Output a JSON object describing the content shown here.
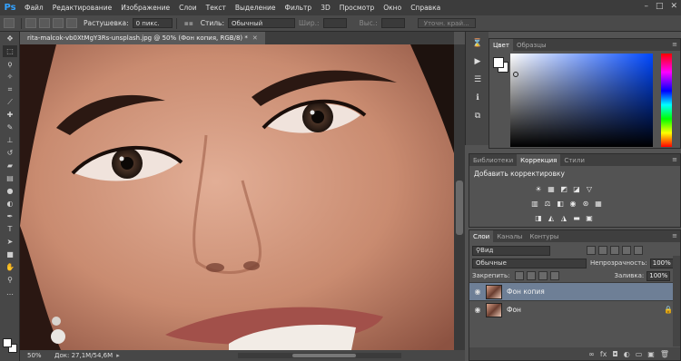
{
  "app": {
    "logo": "Ps"
  },
  "menu": [
    "Файл",
    "Редактирование",
    "Изображение",
    "Слои",
    "Текст",
    "Выделение",
    "Фильтр",
    "3D",
    "Просмотр",
    "Окно",
    "Справка"
  ],
  "options": {
    "feather_label": "Растушевка:",
    "feather_value": "0 пикс.",
    "style_label": "Стиль:",
    "style_value": "Обычный",
    "width_label": "Шир.:",
    "height_label": "Выс.:",
    "refine_button": "Уточн. край..."
  },
  "document": {
    "tab_title": "rita-malcok-vb0XtMgY3Rs-unsplash.jpg @ 50% (Фон копия, RGB/8) *",
    "zoom": "50%",
    "doc_info": "Док: 27,1M/54,6M"
  },
  "color_panel": {
    "tabs": [
      "Цвет",
      "Образцы"
    ],
    "active_tab": "Цвет"
  },
  "adjust_panel": {
    "tabs": [
      "Библиотеки",
      "Коррекция",
      "Стили"
    ],
    "active_tab": "Коррекция",
    "title": "Добавить корректировку"
  },
  "layers_panel": {
    "tabs": [
      "Слои",
      "Каналы",
      "Контуры"
    ],
    "filter_label": "Вид",
    "blend_mode": "Обычные",
    "opacity_label": "Непрозрачность:",
    "opacity_value": "100%",
    "lock_label": "Закрепить:",
    "fill_label": "Заливка:",
    "fill_value": "100%",
    "layers": [
      {
        "name": "Фон копия",
        "selected": true,
        "locked": false
      },
      {
        "name": "Фон",
        "selected": false,
        "locked": true
      }
    ]
  }
}
